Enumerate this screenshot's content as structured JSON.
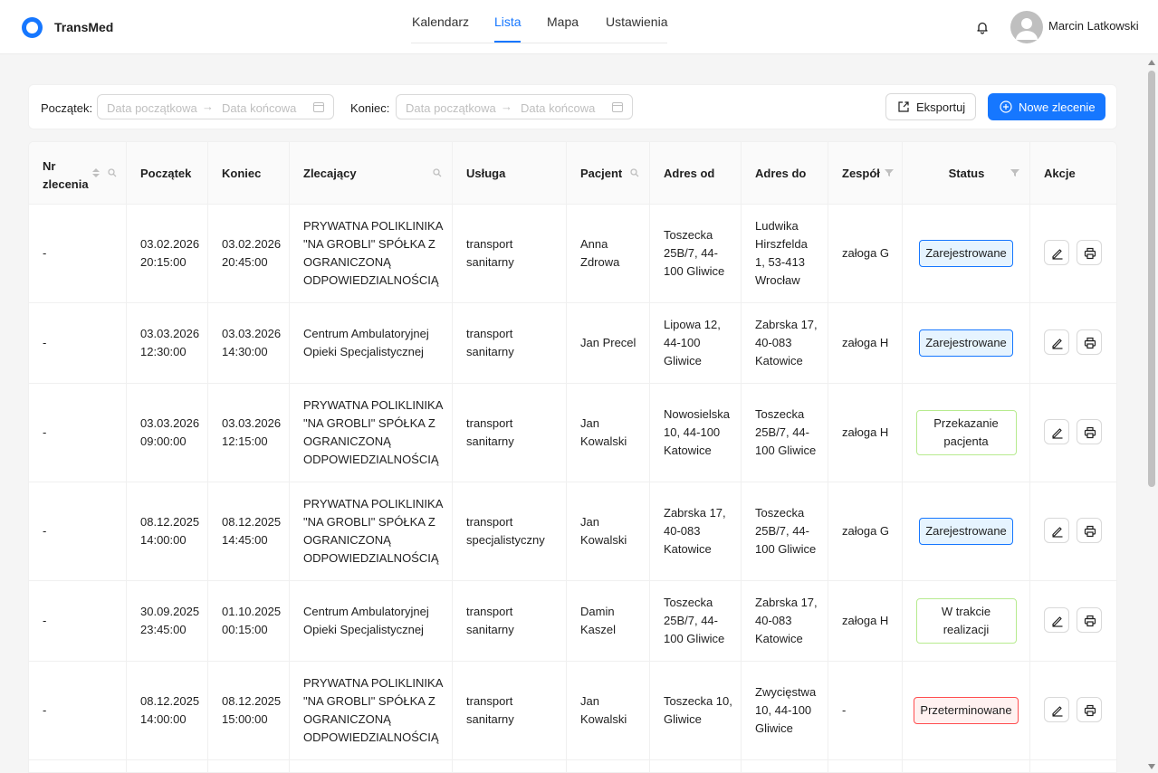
{
  "app": {
    "brand": "TransMed"
  },
  "nav": {
    "tabs": [
      "Kalendarz",
      "Lista",
      "Mapa",
      "Ustawienia"
    ],
    "active": "Lista"
  },
  "user": {
    "name": "Marcin Latkowski"
  },
  "filters": {
    "start_label": "Początek",
    "end_label": "Koniec",
    "range_start_placeholder": "Data początkowa",
    "range_end_placeholder": "Data końcowa",
    "export_label": "Eksportuj",
    "new_label": "Nowe zlecenie"
  },
  "table": {
    "headers": {
      "nr": "Nr zlecenia",
      "start": "Początek",
      "end": "Koniec",
      "client": "Zlecający",
      "service": "Usługa",
      "patient": "Pacjent",
      "from": "Adres od",
      "to": "Adres do",
      "team": "Zespół",
      "status": "Status",
      "actions": "Akcje"
    },
    "rows": [
      {
        "nr": "-",
        "start": "03.02.2026\n20:15:00",
        "end": "03.02.2026\n20:45:00",
        "client": "PRYWATNA POLIKLINIKA\n\"NA GROBLI\" SPÓŁKA Z\nOGRANICZONĄ\nODPOWIEDZIALNOŚCIĄ",
        "service": "transport\nsanitarny",
        "patient": "Anna\nZdrowa",
        "from": "Toszecka\n25B/7, 44-\n100 Gliwice",
        "to": "Ludwika\nHirszfelda\n1, 53-413\nWrocław",
        "team": "załoga G",
        "status": "Zarejestrowane",
        "status_type": "blue"
      },
      {
        "nr": "-",
        "start": "03.03.2026\n12:30:00",
        "end": "03.03.2026\n14:30:00",
        "client": "Centrum Ambulatoryjnej\nOpieki Specjalistycznej",
        "service": "transport\nsanitarny",
        "patient": "Jan Precel",
        "from": "Lipowa 12,\n44-100\nGliwice",
        "to": "Zabrska 17,\n40-083\nKatowice",
        "team": "załoga H",
        "status": "Zarejestrowane",
        "status_type": "blue"
      },
      {
        "nr": "-",
        "start": "03.03.2026\n09:00:00",
        "end": "03.03.2026\n12:15:00",
        "client": "PRYWATNA POLIKLINIKA\n\"NA GROBLI\" SPÓŁKA Z\nOGRANICZONĄ\nODPOWIEDZIALNOŚCIĄ",
        "service": "transport\nsanitarny",
        "patient": "Jan\nKowalski",
        "from": "Nowosielska\n10, 44-100\nKatowice",
        "to": "Toszecka\n25B/7, 44-\n100 Gliwice",
        "team": "załoga H",
        "status": "Przekazanie\npacjenta",
        "status_type": "green"
      },
      {
        "nr": "-",
        "start": "08.12.2025\n14:00:00",
        "end": "08.12.2025\n14:45:00",
        "client": "PRYWATNA POLIKLINIKA\n\"NA GROBLI\" SPÓŁKA Z\nOGRANICZONĄ\nODPOWIEDZIALNOŚCIĄ",
        "service": "transport\nspecjalistyczny",
        "patient": "Jan\nKowalski",
        "from": "Zabrska 17,\n40-083\nKatowice",
        "to": "Toszecka\n25B/7, 44-\n100 Gliwice",
        "team": "załoga G",
        "status": "Zarejestrowane",
        "status_type": "blue"
      },
      {
        "nr": "-",
        "start": "30.09.2025\n23:45:00",
        "end": "01.10.2025\n00:15:00",
        "client": "Centrum Ambulatoryjnej\nOpieki Specjalistycznej",
        "service": "transport\nsanitarny",
        "patient": "Damin\nKaszel",
        "from": "Toszecka\n25B/7, 44-\n100 Gliwice",
        "to": "Zabrska 17,\n40-083\nKatowice",
        "team": "załoga H",
        "status": "W trakcie\nrealizacji",
        "status_type": "green"
      },
      {
        "nr": "-",
        "start": "08.12.2025\n14:00:00",
        "end": "08.12.2025\n15:00:00",
        "client": "PRYWATNA POLIKLINIKA\n\"NA GROBLI\" SPÓŁKA Z\nOGRANICZONĄ\nODPOWIEDZIALNOŚCIĄ",
        "service": "transport\nsanitarny",
        "patient": "Jan\nKowalski",
        "from": "Toszecka 10,\nGliwice",
        "to": "Zwycięstwa\n10, 44-100\nGliwice",
        "team": "-",
        "status": "Przeterminowane",
        "status_type": "red"
      }
    ]
  },
  "colors": {
    "primary": "#1677ff",
    "registered": "#1677ff",
    "in_progress": "#b7eb8f",
    "overdue": "#ff4d4f"
  }
}
